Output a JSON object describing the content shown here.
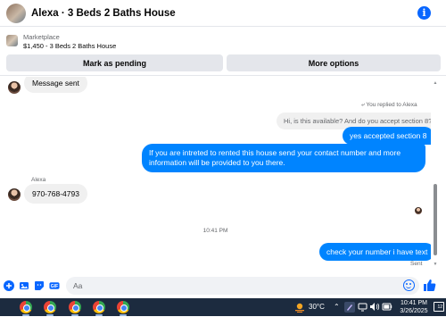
{
  "header": {
    "title": "Alexa · 3 Beds 2 Baths House",
    "info_icon": "info-icon"
  },
  "marketplace": {
    "label": "Marketplace",
    "listing": "$1,450 - 3 Beds 2 Baths House"
  },
  "actions": {
    "pending_label": "Mark as pending",
    "more_label": "More options"
  },
  "messages": {
    "m1": "Message sent",
    "reply_note": "You replied to Alexa",
    "quoted": "Hi, is this available? And do you accept section 8?",
    "m2": "yes accepted section 8",
    "m3": "If you are intreted to rented this house send your contact number and more information will be provided to you there.",
    "sender_name": "Alexa",
    "m4": "970-768-4793",
    "time_separator": "10:41 PM",
    "m5": "check your number i have text",
    "status": "Sent"
  },
  "composer": {
    "placeholder": "Aa"
  },
  "taskbar": {
    "temperature": "30°C",
    "time": "10:41 PM",
    "date": "3/26/2025",
    "notifications": "12"
  },
  "colors": {
    "accent": "#0866ff",
    "bubble_out": "#0084ff",
    "bubble_in": "#f0f0f0",
    "taskbar": "#1c2b3f"
  }
}
